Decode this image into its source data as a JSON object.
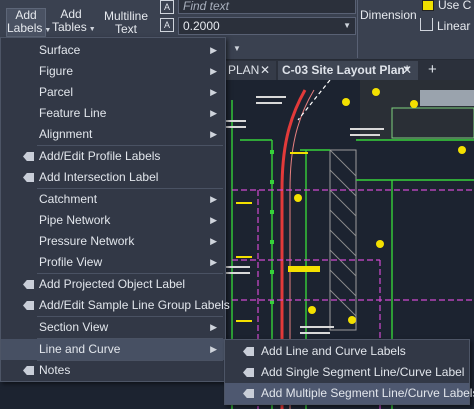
{
  "ribbon": {
    "add_labels": {
      "line1": "Add",
      "line2": "Labels"
    },
    "add_tables": {
      "line1": "Add",
      "line2": "Tables"
    },
    "multiline_text": {
      "line1": "Multiline",
      "line2": "Text"
    },
    "find_placeholder": "Find text",
    "scale_value": "0.2000",
    "dimension": "Dimension",
    "use_color_label": "Use C",
    "linear": "Linear"
  },
  "tabs": [
    {
      "label": "PLAN"
    },
    {
      "label": "C-03 Site Layout Plan*"
    }
  ],
  "menu": {
    "items": [
      {
        "label": "Surface",
        "submenu": true
      },
      {
        "label": "Figure",
        "submenu": true
      },
      {
        "label": "Parcel",
        "submenu": true
      },
      {
        "label": "Feature Line",
        "submenu": true
      },
      {
        "label": "Alignment",
        "submenu": true
      },
      {
        "label": "Add/Edit Profile Labels"
      },
      {
        "label": "Add Intersection Label"
      },
      {
        "label": "Catchment",
        "submenu": true
      },
      {
        "label": "Pipe Network",
        "submenu": true
      },
      {
        "label": "Pressure Network",
        "submenu": true
      },
      {
        "label": "Profile View",
        "submenu": true
      },
      {
        "label": "Add Projected Object Label"
      },
      {
        "label": "Add/Edit Sample Line Group Labels"
      },
      {
        "label": "Section View",
        "submenu": true
      },
      {
        "label": "Line and Curve",
        "submenu": true,
        "active": true
      },
      {
        "label": "Notes"
      }
    ]
  },
  "submenu": {
    "items": [
      {
        "label": "Add Line and Curve Labels"
      },
      {
        "label": "Add Single Segment Line/Curve Label"
      },
      {
        "label": "Add Multiple Segment Line/Curve Labels",
        "hover": true
      }
    ]
  },
  "icons": {
    "arrow": "chevron-right-icon",
    "tag": "tag-icon"
  },
  "colors": {
    "ribbon_bg": "#3a4150",
    "menu_bg": "#323846",
    "menu_active": "#475063",
    "canvas_bg": "#1c2330",
    "use_color_swatch": "#f0e000"
  }
}
